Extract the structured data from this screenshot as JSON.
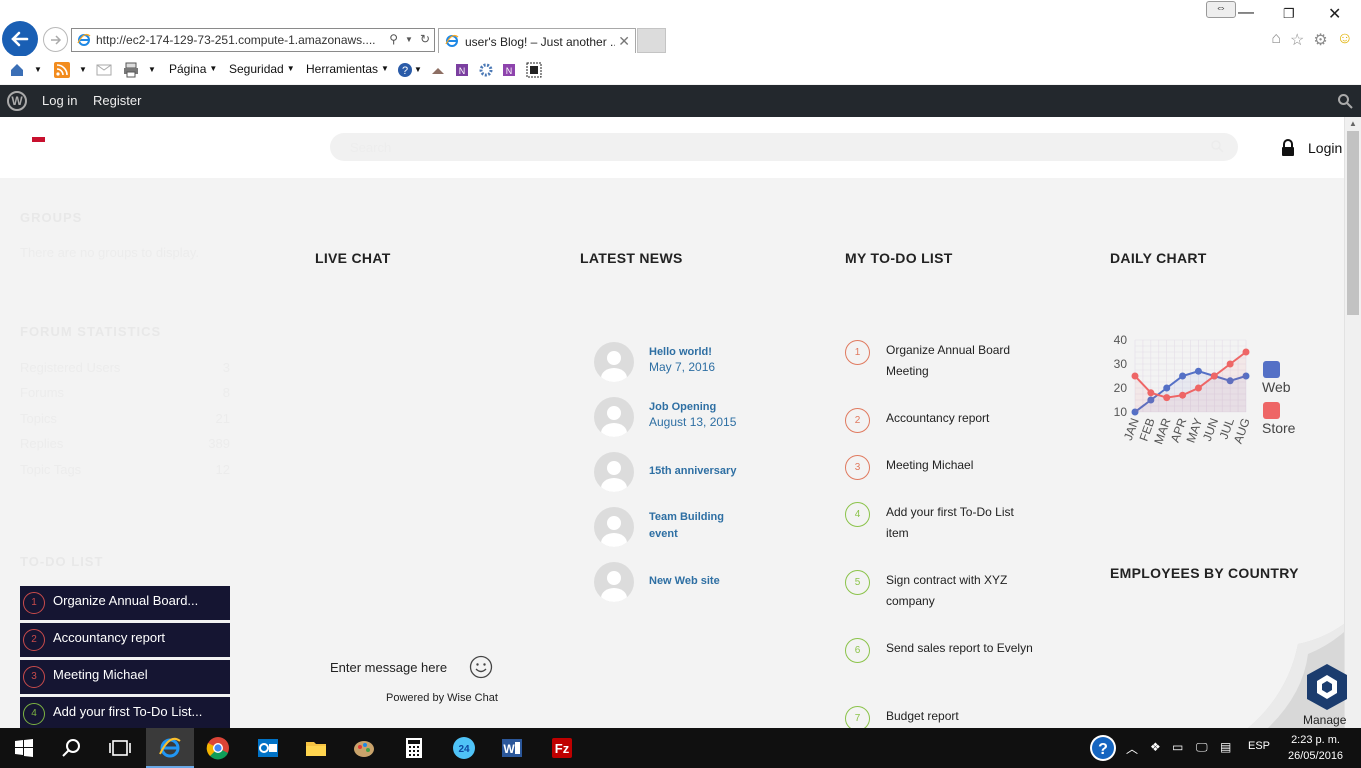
{
  "browser": {
    "url": "http://ec2-174-129-73-251.compute-1.amazonaws....",
    "tab_title": "user's Blog! – Just another ...",
    "commands": [
      "Página",
      "Seguridad",
      "Herramientas"
    ]
  },
  "adminbar": {
    "login": "Log in",
    "register": "Register"
  },
  "header": {
    "search_placeholder": "Search",
    "login": "Login"
  },
  "sidebar": {
    "groups_title": "GROUPS",
    "groups_empty": "There are no groups to display.",
    "forum_title": "FORUM STATISTICS",
    "stats": [
      {
        "label": "Registered Users",
        "value": "3"
      },
      {
        "label": "Forums",
        "value": "8"
      },
      {
        "label": "Topics",
        "value": "21"
      },
      {
        "label": "Replies",
        "value": "389"
      },
      {
        "label": "Topic Tags",
        "value": "12"
      }
    ],
    "todo_title": "TO-DO LIST",
    "todos": [
      {
        "num": "1",
        "text": "Organize Annual Board..."
      },
      {
        "num": "2",
        "text": "Accountancy report"
      },
      {
        "num": "3",
        "text": "Meeting Michael"
      },
      {
        "num": "4",
        "text": "Add your first To-Do List..."
      }
    ]
  },
  "live_chat": {
    "title": "LIVE CHAT",
    "placeholder": "Enter message here",
    "powered": "Powered by Wise Chat"
  },
  "news": {
    "title": "LATEST NEWS",
    "items": [
      {
        "title": "Hello world!",
        "date": "May 7, 2016"
      },
      {
        "title": "Job Opening",
        "date": "August 13, 2015"
      },
      {
        "title": "15th anniversary",
        "date": ""
      },
      {
        "title": "Team Building event",
        "date": ""
      },
      {
        "title": "New Web site",
        "date": ""
      }
    ]
  },
  "todo_widget": {
    "title": "MY TO-DO LIST",
    "items": [
      {
        "num": "1",
        "text": "Organize Annual Board Meeting"
      },
      {
        "num": "2",
        "text": "Accountancy report"
      },
      {
        "num": "3",
        "text": "Meeting Michael"
      },
      {
        "num": "4",
        "text": "Add your first To-Do List item"
      },
      {
        "num": "5",
        "text": "Sign contract with XYZ company"
      },
      {
        "num": "6",
        "text": "Send sales report to Evelyn"
      },
      {
        "num": "7",
        "text": "Budget report"
      }
    ]
  },
  "daily_chart": {
    "title": "DAILY CHART"
  },
  "employees": {
    "title": "EMPLOYEES BY COUNTRY"
  },
  "manage": {
    "label": "Manage"
  },
  "chart_data": {
    "type": "line",
    "categories": [
      "JAN",
      "FEB",
      "MAR",
      "APR",
      "MAY",
      "JUN",
      "JUL",
      "AUG"
    ],
    "series": [
      {
        "name": "Web",
        "color": "#5470c6",
        "values": [
          10,
          15,
          20,
          25,
          27,
          25,
          23,
          25
        ]
      },
      {
        "name": "Store",
        "color": "#ee6666",
        "values": [
          25,
          18,
          16,
          17,
          20,
          25,
          30,
          35
        ]
      }
    ],
    "yticks": [
      10,
      20,
      30,
      40
    ],
    "ylim": [
      10,
      40
    ],
    "legend": "right"
  },
  "taskbar": {
    "lang": "ESP",
    "time": "2:23 p. m.",
    "date": "26/05/2016"
  }
}
